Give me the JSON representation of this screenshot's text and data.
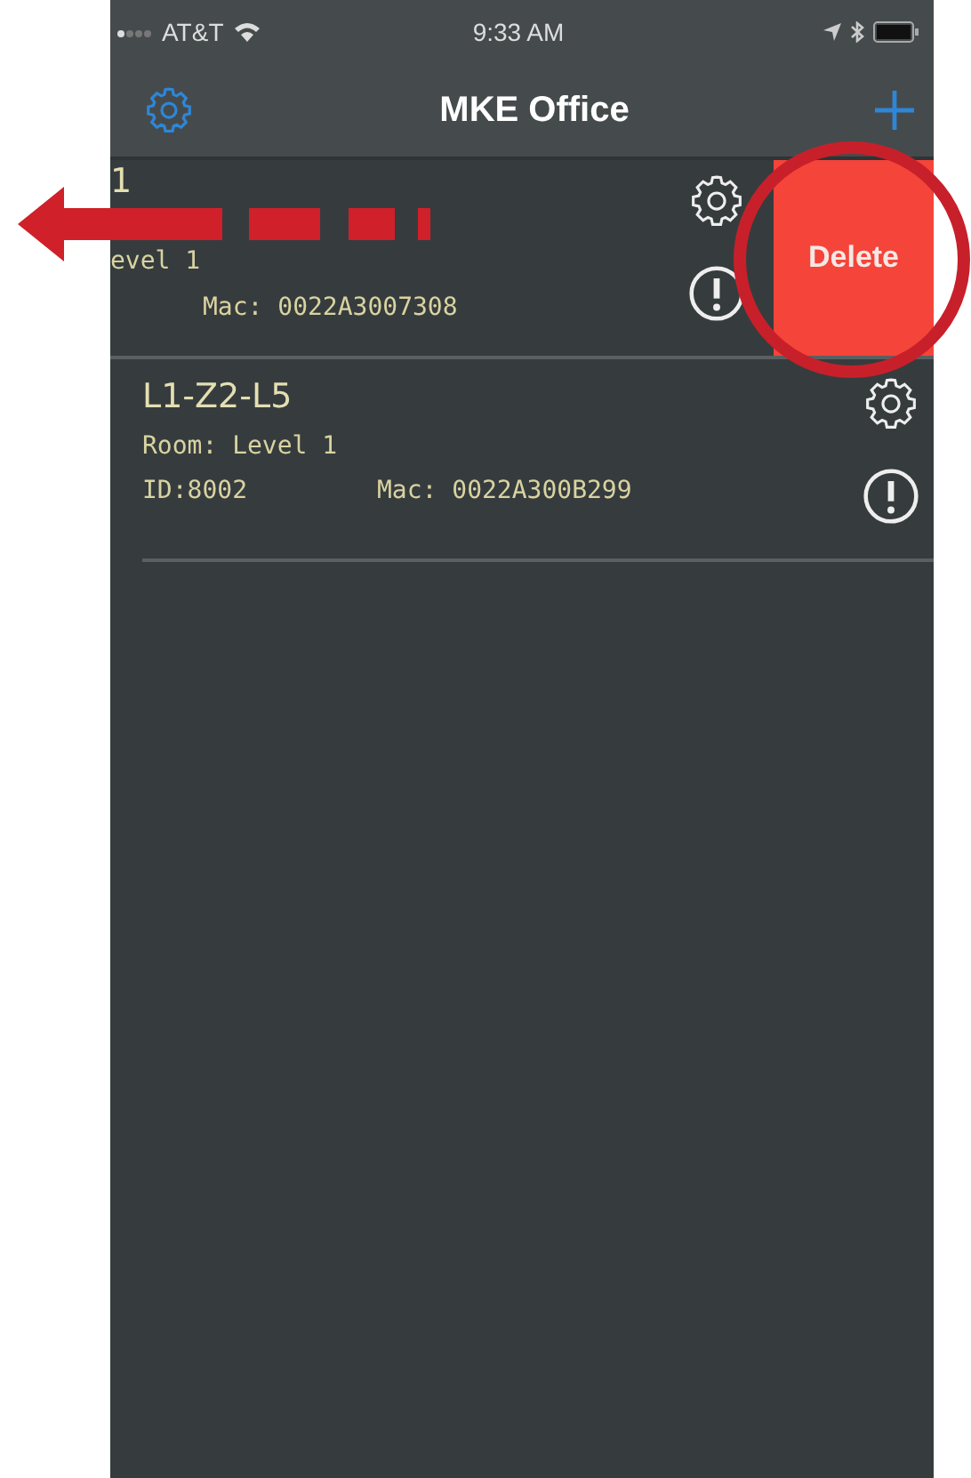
{
  "status_bar": {
    "carrier": "AT&T",
    "time": "9:33 AM"
  },
  "nav": {
    "title": "MKE Office"
  },
  "devices": [
    {
      "kind": "swiped",
      "title": "1",
      "room": "evel 1",
      "mac": "Mac: 0022A3007308",
      "action": "Delete"
    },
    {
      "kind": "normal",
      "title": "L1-Z2-L5",
      "room": "Room: Level 1",
      "id": "ID:8002",
      "mac": "Mac: 0022A300B299"
    }
  ]
}
